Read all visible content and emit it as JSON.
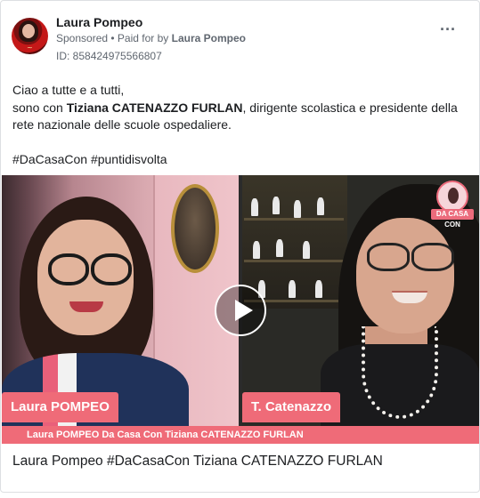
{
  "post": {
    "author": "Laura Pompeo",
    "sponsored_label": "Sponsored",
    "separator": " • ",
    "paid_for_prefix": "Paid for by ",
    "paid_for_name": "Laura Pompeo",
    "ad_id": "ID: 858424975566807",
    "more_icon": "more-options-icon",
    "body_line1": "Ciao a tutte e a tutti,",
    "body_line2_prefix": "sono con ",
    "body_line2_bold": "Tiziana CATENAZZO FURLAN",
    "body_line2_suffix": ", dirigente scolastica e presidente della",
    "body_line3": "rete nazionale delle scuole ospedaliere.",
    "hashtags": "#DaCasaCon #puntidisvolta"
  },
  "video": {
    "badge_text": "DA CASA CON",
    "left_name": "Laura POMPEO",
    "right_name": "T. Catenazzo",
    "caption": "Laura POMPEO Da Casa Con Tiziana CATENAZZO FURLAN",
    "play_icon": "play-icon",
    "accent_color": "#ef6b78"
  },
  "link": {
    "title": "Laura Pompeo #DaCasaCon Tiziana CATENAZZO FURLAN"
  }
}
